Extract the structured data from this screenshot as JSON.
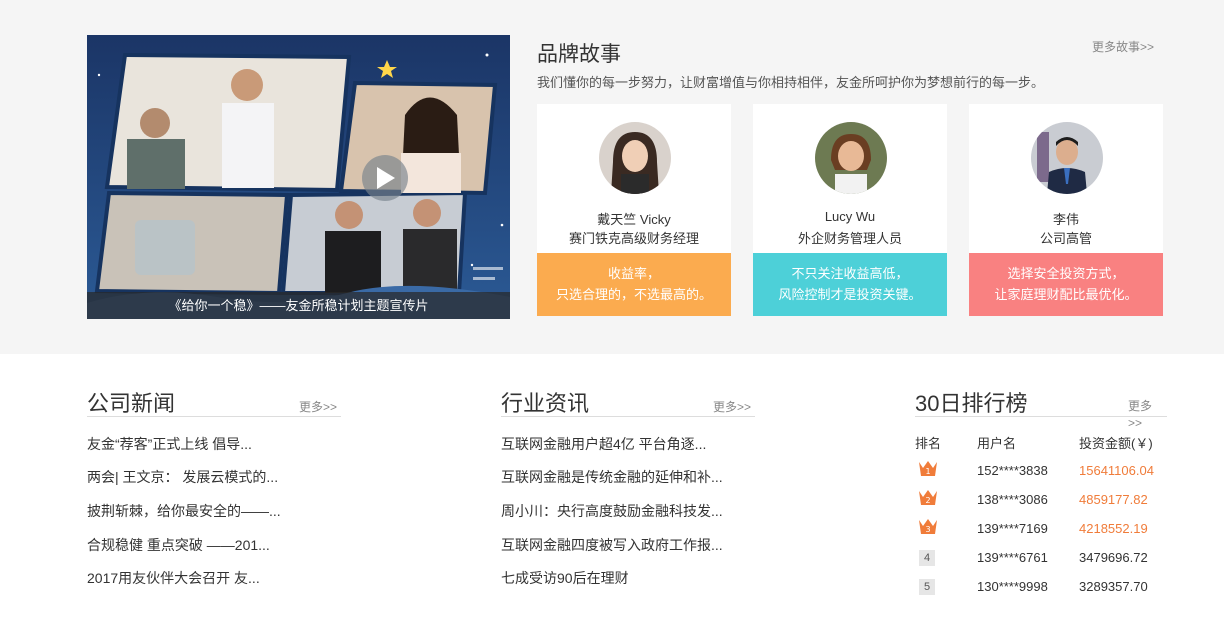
{
  "video": {
    "caption": "《给你一个稳》——友金所稳计划主题宣传片"
  },
  "brand": {
    "title": "品牌故事",
    "more": "更多故事>>",
    "description": "我们懂你的每一步努力，让财富增值与你相持相伴，友金所呵护你为梦想前行的每一步。",
    "cards": [
      {
        "name": "戴天竺 Vicky",
        "role": "赛门铁克高级财务经理",
        "quote_line1": "收益率，",
        "quote_line2": "只选合理的，不选最高的。",
        "color": "#fbab4f"
      },
      {
        "name": "Lucy Wu",
        "role": "外企财务管理人员",
        "quote_line1": "不只关注收益高低，",
        "quote_line2": "风险控制才是投资关键。",
        "color": "#4dd0d8"
      },
      {
        "name": "李伟",
        "role": "公司高管",
        "quote_line1": "选择安全投资方式，",
        "quote_line2": "让家庭理财配比最优化。",
        "color": "#f98181"
      }
    ]
  },
  "company_news": {
    "title": "公司新闻",
    "more": "更多>>",
    "items": [
      "友金“荐客”正式上线 倡导...",
      "两会| 王文京： 发展云模式的...",
      "披荆斩棘，给你最安全的——...",
      "合规稳健 重点突破 ——201...",
      "2017用友伙伴大会召开 友..."
    ]
  },
  "industry_news": {
    "title": "行业资讯",
    "more": "更多>>",
    "items": [
      "互联网金融用户超4亿 平台角逐...",
      "互联网金融是传统金融的延伸和补...",
      "周小川：央行高度鼓励金融科技发...",
      "互联网金融四度被写入政府工作报...",
      "七成受访90后在理财"
    ]
  },
  "ranking": {
    "title": "30日排行榜",
    "more": "更多>>",
    "headers": {
      "rank": "排名",
      "user": "用户名",
      "amount": "投资金额(￥)"
    },
    "rows": [
      {
        "rank": "1",
        "user": "152****3838",
        "amount": "15641106.04"
      },
      {
        "rank": "2",
        "user": "138****3086",
        "amount": "4859177.82"
      },
      {
        "rank": "3",
        "user": "139****7169",
        "amount": "4218552.19"
      },
      {
        "rank": "4",
        "user": "139****6761",
        "amount": "3479696.72"
      },
      {
        "rank": "5",
        "user": "130****9998",
        "amount": "3289357.70"
      }
    ],
    "accent_color": "#f07c3a"
  }
}
